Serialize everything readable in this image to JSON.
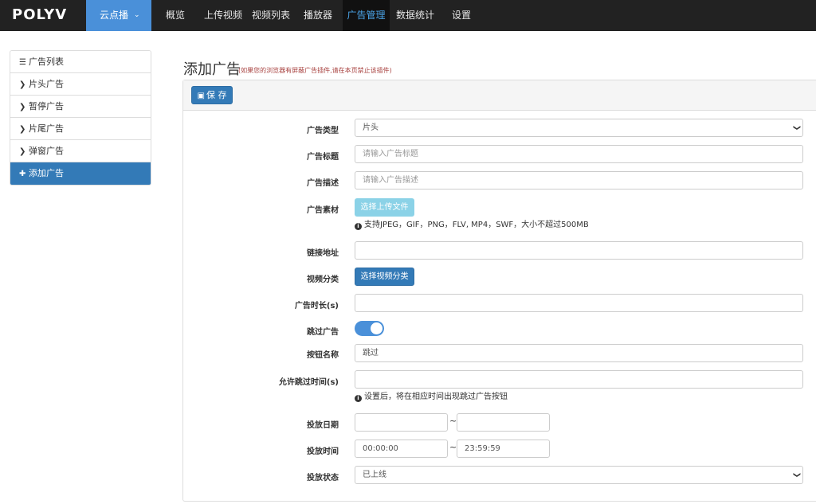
{
  "nav": {
    "logo": "POLYV",
    "cloud": "云点播",
    "items": [
      "概览",
      "上传视频",
      "视频列表",
      "播放器",
      "广告管理",
      "数据统计",
      "设置"
    ]
  },
  "sidebar": {
    "items": [
      {
        "icon": "list-icon",
        "label": "广告列表"
      },
      {
        "icon": "chevron-right-icon",
        "label": "片头广告"
      },
      {
        "icon": "chevron-right-icon",
        "label": "暂停广告"
      },
      {
        "icon": "chevron-right-icon",
        "label": "片尾广告"
      },
      {
        "icon": "chevron-right-icon",
        "label": "弹窗广告"
      },
      {
        "icon": "plus-icon",
        "label": "添加广告"
      }
    ]
  },
  "page": {
    "title": "添加广告",
    "note": "(如果您的浏览器有屏蔽广告插件,请在本页禁止该插件)"
  },
  "toolbar": {
    "save_label": "保 存"
  },
  "form": {
    "type_label": "广告类型",
    "type_value": "片头",
    "title_label": "广告标题",
    "title_placeholder": "请输入广告标题",
    "desc_label": "广告描述",
    "desc_placeholder": "请输入广告描述",
    "material_label": "广告素材",
    "material_button": "选择上传文件",
    "material_help": "支持JPEG，GIF，PNG，FLV, MP4，SWF，大小不超过500MB",
    "link_label": "链接地址",
    "category_label": "视频分类",
    "category_button": "选择视频分类",
    "duration_label": "广告时长(s)",
    "skip_label": "跳过广告",
    "skip_enabled": true,
    "button_name_label": "按钮名称",
    "button_name_value": "跳过",
    "skip_time_label": "允许跳过时间(s)",
    "skip_time_help": "设置后，将在相应时间出现跳过广告按钮",
    "date_label": "投放日期",
    "date_sep": "~",
    "time_label": "投放时间",
    "time_start": "00:00:00",
    "time_end": "23:59:59",
    "time_sep": "~",
    "status_label": "投放状态",
    "status_value": "已上线"
  }
}
